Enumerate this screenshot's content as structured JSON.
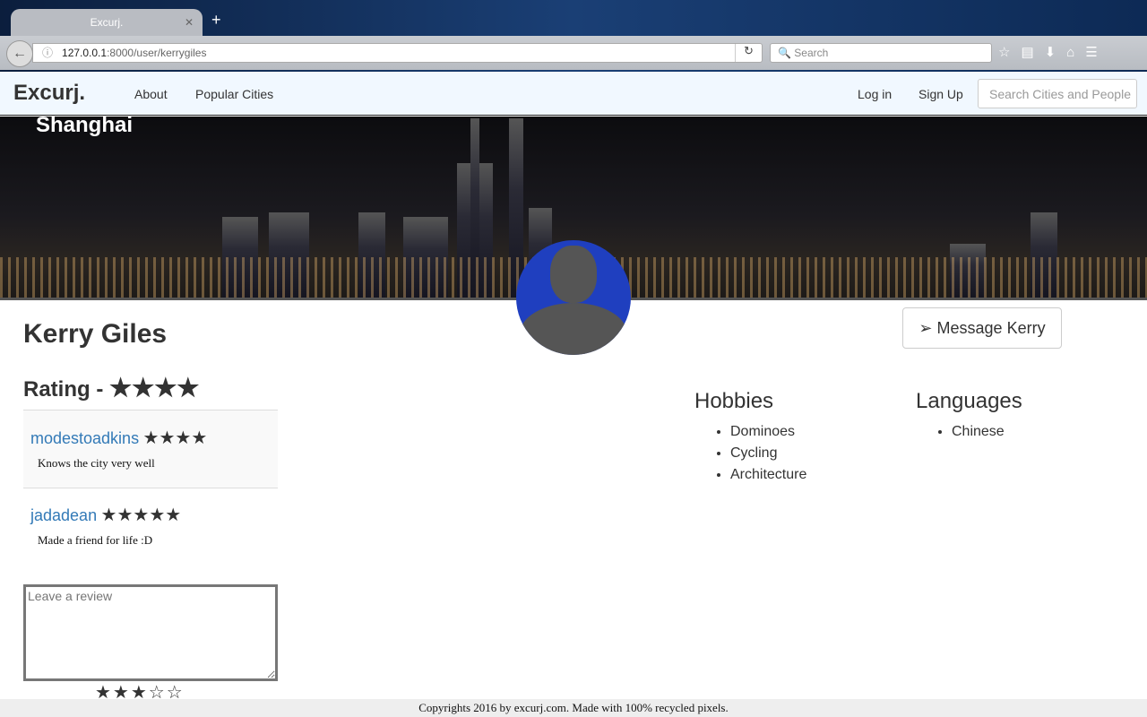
{
  "browser": {
    "tab_title": "Excurj.",
    "url_host": "127.0.0.1",
    "url_path": ":8000/user/kerrygiles",
    "search_placeholder": "Search"
  },
  "nav": {
    "brand": "Excurj.",
    "about": "About",
    "popular": "Popular Cities",
    "login": "Log in",
    "signup": "Sign Up",
    "search_placeholder": "Search Cities and People"
  },
  "banner": {
    "city": "Shanghai"
  },
  "profile": {
    "name": "Kerry Giles",
    "rating_label": "Rating -",
    "rating_stars": "★★★★",
    "message_button": "Message Kerry"
  },
  "reviews": [
    {
      "user": "modestoadkins",
      "stars": "★★★★",
      "text": "Knows the city very well"
    },
    {
      "user": "jadadean",
      "stars": "★★★★★",
      "text": "Made a friend for life :D"
    }
  ],
  "review_form": {
    "placeholder": "Leave a review",
    "stars": "★★★☆☆"
  },
  "hobbies": {
    "title": "Hobbies",
    "items": [
      "Dominoes",
      "Cycling",
      "Architecture"
    ]
  },
  "languages": {
    "title": "Languages",
    "items": [
      "Chinese"
    ]
  },
  "footer": "Copyrights 2016 by excurj.com. Made with 100% recycled pixels."
}
